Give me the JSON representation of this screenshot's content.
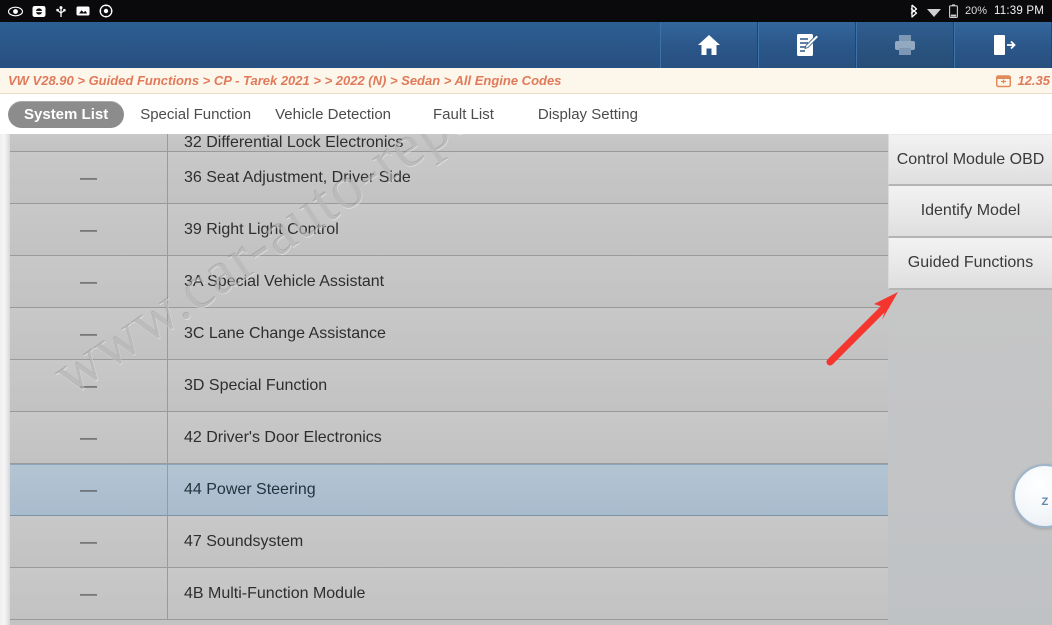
{
  "statusbar": {
    "left_icons": [
      "eye-icon",
      "sync-icon",
      "usb-icon",
      "sd-card-icon",
      "settings-icon"
    ],
    "right_icons": [
      "bluetooth-icon",
      "wifi-icon",
      "battery-icon"
    ],
    "battery_pct": "20%",
    "time": "11:39 PM"
  },
  "toolbar": {
    "buttons": [
      {
        "name": "home-button",
        "icon": "home-icon",
        "enabled": true
      },
      {
        "name": "report-button",
        "icon": "edit-report-icon",
        "enabled": true
      },
      {
        "name": "print-button",
        "icon": "printer-icon",
        "enabled": false
      },
      {
        "name": "exit-button",
        "icon": "exit-icon",
        "enabled": true
      }
    ]
  },
  "breadcrumb": {
    "text": "VW V28.90 > Guided Functions > CP - Tarek 2021 > > 2022 (N) > Sedan > All Engine Codes",
    "voltage": "12.35",
    "voltage_icon": "battery-voltage-icon"
  },
  "tabs": [
    {
      "label": "System List",
      "active": true
    },
    {
      "label": "Special Function",
      "active": false
    },
    {
      "label": "Vehicle Detection",
      "active": false
    },
    {
      "label": "Fault List",
      "active": false
    },
    {
      "label": "Display Setting",
      "active": false
    }
  ],
  "table": {
    "rows": [
      {
        "status": "",
        "label": "32 Differential Lock Electronics",
        "selected": false,
        "clipped": true
      },
      {
        "status": "—",
        "label": "36 Seat Adjustment, Driver Side",
        "selected": false,
        "clipped": false
      },
      {
        "status": "—",
        "label": "39 Right Light Control",
        "selected": false,
        "clipped": false
      },
      {
        "status": "—",
        "label": "3A Special Vehicle Assistant",
        "selected": false,
        "clipped": false
      },
      {
        "status": "—",
        "label": "3C Lane Change Assistance",
        "selected": false,
        "clipped": false
      },
      {
        "status": "—",
        "label": "3D Special Function",
        "selected": false,
        "clipped": false
      },
      {
        "status": "—",
        "label": "42 Driver's Door Electronics",
        "selected": false,
        "clipped": false
      },
      {
        "status": "—",
        "label": "44 Power Steering",
        "selected": true,
        "clipped": false
      },
      {
        "status": "—",
        "label": "47 Soundsystem",
        "selected": false,
        "clipped": false
      },
      {
        "status": "—",
        "label": "4B Multi-Function Module",
        "selected": false,
        "clipped": false
      }
    ]
  },
  "right_panel": {
    "buttons": [
      {
        "label": "Control Module OBD"
      },
      {
        "label": "Identify Model"
      },
      {
        "label": "Guided Functions"
      }
    ],
    "gauge_label": "Z"
  },
  "annotation": {
    "arrow_color": "#f4362e",
    "points_to": "Guided Functions"
  },
  "watermark": {
    "text": "www.car-auto-repair.com"
  }
}
